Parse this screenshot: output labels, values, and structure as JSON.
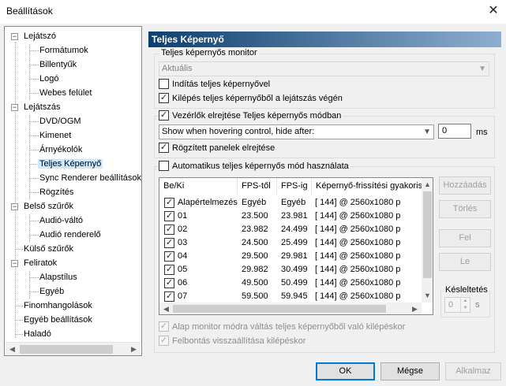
{
  "window": {
    "title": "Beállítások"
  },
  "tree": {
    "items": [
      {
        "label": "Lejátszó"
      },
      {
        "label": "Formátumok"
      },
      {
        "label": "Billentyűk"
      },
      {
        "label": "Logó"
      },
      {
        "label": "Webes felület"
      },
      {
        "label": "Lejátszás"
      },
      {
        "label": "DVD/OGM"
      },
      {
        "label": "Kimenet"
      },
      {
        "label": "Árnyékolók"
      },
      {
        "label": "Teljes Képernyő"
      },
      {
        "label": "Sync Renderer beállítások"
      },
      {
        "label": "Rögzítés"
      },
      {
        "label": "Belső szűrők"
      },
      {
        "label": "Audió-váltó"
      },
      {
        "label": "Audió renderelő"
      },
      {
        "label": "Külső szűrők"
      },
      {
        "label": "Feliratok"
      },
      {
        "label": "Alapstílus"
      },
      {
        "label": "Egyéb"
      },
      {
        "label": "Finomhangolások"
      },
      {
        "label": "Egyéb beállítások"
      },
      {
        "label": "Haladó"
      }
    ],
    "selected": "Teljes Képernyő"
  },
  "panel": {
    "title": "Teljes Képernyő",
    "monitor_group": "Teljes képernyős monitor",
    "monitor_value": "Aktuális",
    "cb_start_fullscreen": "Indítás teljes képernyővel",
    "cb_exit_fullscreen": "Kilépés teljes képernyőből a lejátszás végén",
    "cb_hide_controls": "Vezérlők elrejtése Teljes képernyős módban",
    "hide_mode_value": "Show when hovering control, hide after:",
    "hide_delay_value": "0",
    "hide_delay_unit": "ms",
    "cb_hide_docked": "Rögzített panelek elrejtése",
    "cb_auto_mode": "Automatikus teljes képernyős mód használata",
    "table": {
      "headers": [
        "Be/Ki",
        "FPS-től",
        "FPS-ig",
        "Képernyő-frissítési gyakoriság"
      ],
      "rows": [
        {
          "name": "Alapértelmezés",
          "from": "Egyéb",
          "to": "Egyéb",
          "rate": "[ 144] @ 2560x1080 p"
        },
        {
          "name": "01",
          "from": "23.500",
          "to": "23.981",
          "rate": "[ 144] @ 2560x1080 p"
        },
        {
          "name": "02",
          "from": "23.982",
          "to": "24.499",
          "rate": "[ 144] @ 2560x1080 p"
        },
        {
          "name": "03",
          "from": "24.500",
          "to": "25.499",
          "rate": "[ 144] @ 2560x1080 p"
        },
        {
          "name": "04",
          "from": "29.500",
          "to": "29.981",
          "rate": "[ 144] @ 2560x1080 p"
        },
        {
          "name": "05",
          "from": "29.982",
          "to": "30.499",
          "rate": "[ 144] @ 2560x1080 p"
        },
        {
          "name": "06",
          "from": "49.500",
          "to": "50.499",
          "rate": "[ 144] @ 2560x1080 p"
        },
        {
          "name": "07",
          "from": "59.500",
          "to": "59.945",
          "rate": "[ 144] @ 2560x1080 p"
        }
      ]
    },
    "btn_add": "Hozzáadás",
    "btn_delete": "Törlés",
    "btn_up": "Fel",
    "btn_down": "Le",
    "delay_label": "Késleltetés",
    "delay_value": "0",
    "delay_unit": "s",
    "cb_default_monitor": "Alap monitor módra váltás teljes képernyőből való kilépéskor",
    "cb_restore_resolution": "Felbontás visszaállítása kilépéskor"
  },
  "footer": {
    "ok": "OK",
    "cancel": "Mégse",
    "apply": "Alkalmaz"
  }
}
